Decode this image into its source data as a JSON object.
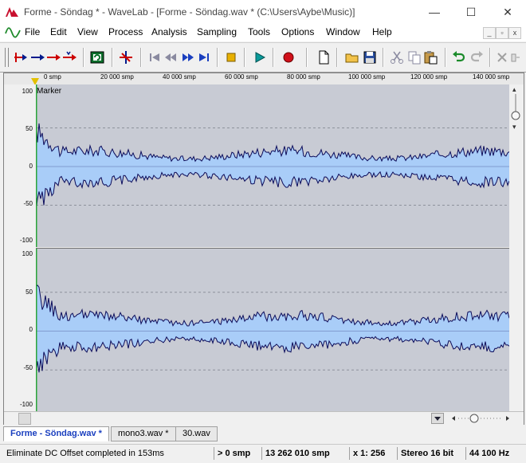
{
  "window": {
    "title": "Forme - Söndag * - WaveLab - [Forme - Söndag.wav * (C:\\Users\\Aybe\\Music)]",
    "minimize": "—",
    "maximize": "☐",
    "close": "✕"
  },
  "menu": {
    "items": [
      "File",
      "Edit",
      "View",
      "Process",
      "Analysis",
      "Sampling",
      "Tools",
      "Options",
      "Window",
      "Help"
    ],
    "mdi_minimize": "_",
    "mdi_restore": "▫",
    "mdi_close": "x"
  },
  "ruler": {
    "labels": [
      "0 smp",
      "20 000 smp",
      "40 000 smp",
      "60 000 smp",
      "80 000 smp",
      "100 000 smp",
      "120 000 smp",
      "140 000 smp"
    ]
  },
  "channels": {
    "y_labels": [
      "100",
      "50",
      "0",
      "-50",
      "-100"
    ],
    "marker_label": "Marker"
  },
  "tabs": [
    {
      "label": "Forme - Söndag.wav *",
      "active": true
    },
    {
      "label": "mono3.wav *",
      "active": false
    },
    {
      "label": "30.wav",
      "active": false
    }
  ],
  "status": {
    "message": "Eliminate DC Offset completed in 153ms",
    "position": "> 0 smp",
    "length": "13 262 010 smp",
    "zoom": "x 1: 256",
    "format": "Stereo  16 bit",
    "rate": "44 100 Hz"
  },
  "colors": {
    "waveform_fill": "#a9cdf8",
    "waveform_line": "#0c0c5a",
    "channel_bg": "#c8cbd4",
    "active_tab": "#1a3fbf"
  },
  "icons": [
    "wavelab-logo-icon",
    "wave-icon",
    "record-icon",
    "play-icon",
    "stop-icon",
    "save-icon",
    "undo-icon",
    "redo-icon"
  ]
}
